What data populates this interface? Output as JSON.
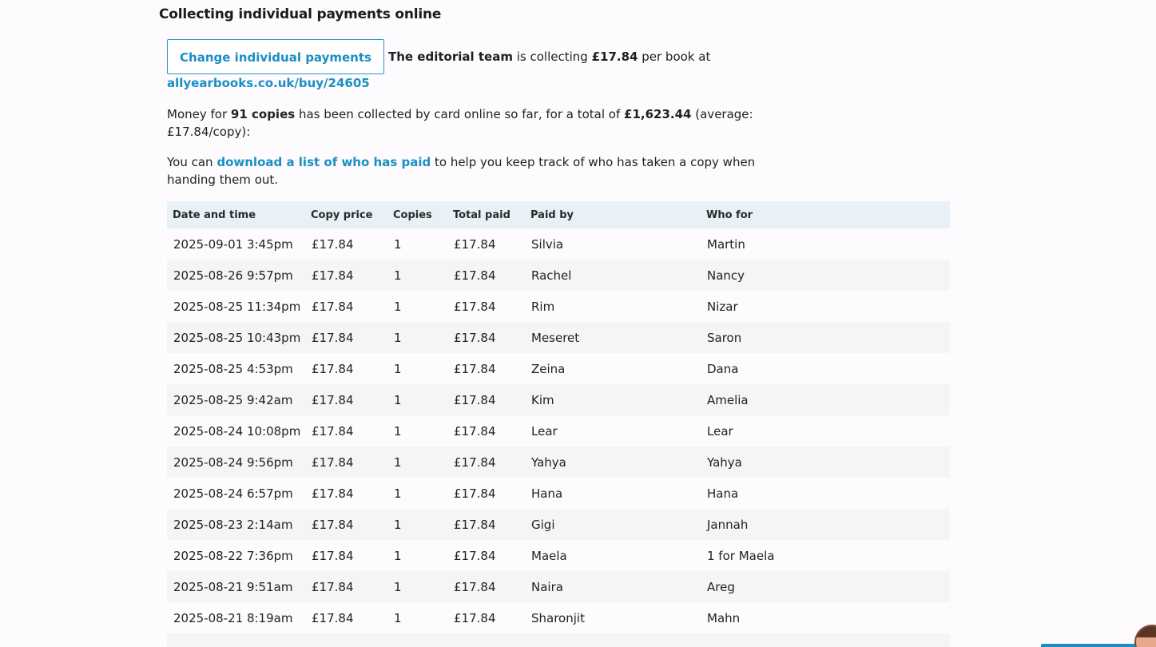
{
  "section": {
    "title": "Collecting individual payments online"
  },
  "intro": {
    "change_button": "Change individual payments",
    "team": "The editorial team",
    "collecting_mid": " is collecting ",
    "price": "£17.84",
    "collecting_end": " per book at",
    "buy_link": "allyearbooks.co.uk/buy/24605"
  },
  "summary": {
    "prefix": "Money for ",
    "copies": "91 copies",
    "middle": " has been collected by card online so far, for a total of ",
    "total": "£1,623.44",
    "suffix": " (average: £17.84/copy):"
  },
  "download": {
    "prefix": "You can ",
    "link": "download a list of who has paid",
    "suffix": " to help you keep track of who has taken a copy when handing them out."
  },
  "table": {
    "headers": [
      "Date and time",
      "Copy price",
      "Copies",
      "Total paid",
      "Paid by",
      "Who for"
    ],
    "rows": [
      [
        "2025-09-01 3:45pm",
        "£17.84",
        "1",
        "£17.84",
        "Silvia",
        "Martin"
      ],
      [
        "2025-08-26 9:57pm",
        "£17.84",
        "1",
        "£17.84",
        "Rachel",
        "Nancy"
      ],
      [
        "2025-08-25 11:34pm",
        "£17.84",
        "1",
        "£17.84",
        "Rim",
        "Nizar"
      ],
      [
        "2025-08-25 10:43pm",
        "£17.84",
        "1",
        "£17.84",
        "Meseret",
        "Saron"
      ],
      [
        "2025-08-25 4:53pm",
        "£17.84",
        "1",
        "£17.84",
        "Zeina",
        "Dana"
      ],
      [
        "2025-08-25 9:42am",
        "£17.84",
        "1",
        "£17.84",
        "Kim",
        "Amelia"
      ],
      [
        "2025-08-24 10:08pm",
        "£17.84",
        "1",
        "£17.84",
        "Lear",
        "Lear"
      ],
      [
        "2025-08-24 9:56pm",
        "£17.84",
        "1",
        "£17.84",
        "Yahya",
        "Yahya"
      ],
      [
        "2025-08-24 6:57pm",
        "£17.84",
        "1",
        "£17.84",
        "Hana",
        "Hana"
      ],
      [
        "2025-08-23 2:14am",
        "£17.84",
        "1",
        "£17.84",
        "Gigi",
        "Jannah"
      ],
      [
        "2025-08-22 7:36pm",
        "£17.84",
        "1",
        "£17.84",
        "Maela",
        "1 for Maela"
      ],
      [
        "2025-08-21 9:51am",
        "£17.84",
        "1",
        "£17.84",
        "Naira",
        "Areg"
      ],
      [
        "2025-08-21 8:19am",
        "£17.84",
        "1",
        "£17.84",
        "Sharonjit",
        "Mahn"
      ],
      [
        "",
        "",
        "",
        "",
        "",
        ""
      ]
    ]
  },
  "widgets": {
    "chat_icon": "support-avatar-icon",
    "accent_color": "#1a8fc4"
  }
}
